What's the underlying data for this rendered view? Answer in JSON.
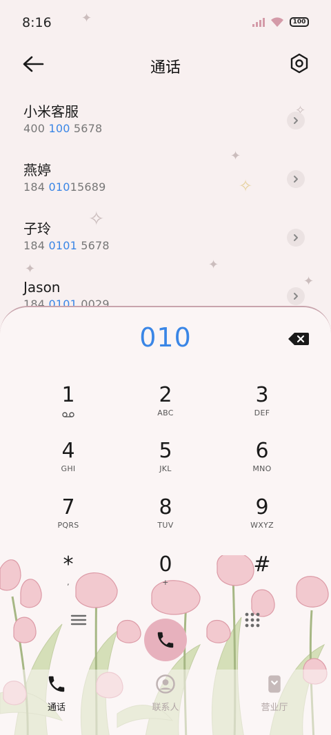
{
  "status_bar": {
    "time": "8:16",
    "battery": "100"
  },
  "header": {
    "title": "通话"
  },
  "contacts": [
    {
      "name": "小米客服",
      "number_parts": [
        "400 ",
        "100",
        " 5678"
      ]
    },
    {
      "name": "燕婷",
      "number_parts": [
        "184 ",
        "010",
        "15689"
      ]
    },
    {
      "name": "子玲",
      "number_parts": [
        "184 ",
        "0101",
        " 5678"
      ]
    },
    {
      "name": "Jason",
      "number_parts": [
        "184 ",
        "0101",
        " 0029"
      ]
    }
  ],
  "dialer": {
    "input": "010",
    "keys": [
      {
        "digit": "1",
        "letters": ""
      },
      {
        "digit": "2",
        "letters": "ABC"
      },
      {
        "digit": "3",
        "letters": "DEF"
      },
      {
        "digit": "4",
        "letters": "GHI"
      },
      {
        "digit": "5",
        "letters": "JKL"
      },
      {
        "digit": "6",
        "letters": "MNO"
      },
      {
        "digit": "7",
        "letters": "PQRS"
      },
      {
        "digit": "8",
        "letters": "TUV"
      },
      {
        "digit": "9",
        "letters": "WXYZ"
      },
      {
        "digit": "*",
        "letters": ","
      },
      {
        "digit": "0",
        "letters": "+"
      },
      {
        "digit": "#",
        "letters": ""
      }
    ]
  },
  "bottom_nav": {
    "items": [
      {
        "label": "通话",
        "icon": "phone-icon",
        "active": true
      },
      {
        "label": "联系人",
        "icon": "contacts-icon",
        "active": false
      },
      {
        "label": "营业厅",
        "icon": "store-icon",
        "active": false
      }
    ]
  },
  "colors": {
    "accent": "#3a86e6",
    "call_button": "#e7b1bd",
    "background": "#f8f0f0"
  }
}
